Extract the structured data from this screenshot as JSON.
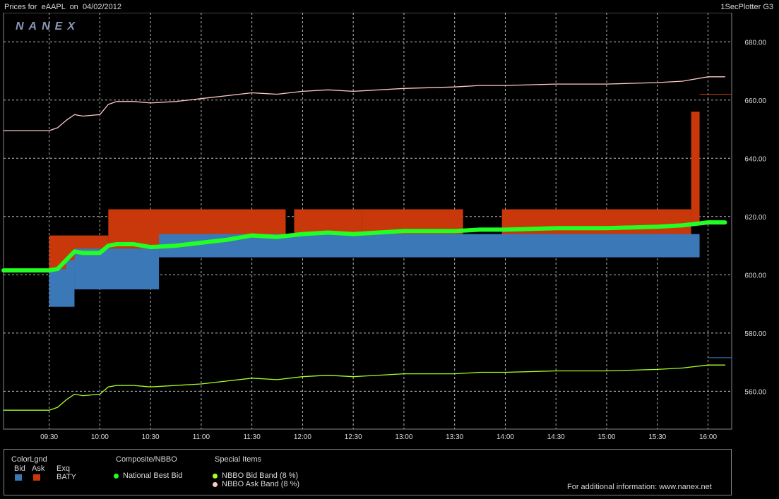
{
  "header": {
    "title_prefix": "Prices for",
    "symbol": "eAAPL",
    "on_label": "on",
    "date": "04/02/2012",
    "app_name": "1SecPlotter G3"
  },
  "logo_text": "NANEX",
  "chart_data": {
    "type": "line",
    "xlim": [
      "09:03",
      "16:14"
    ],
    "ylim": [
      547,
      690
    ],
    "grid": true,
    "x_ticks": [
      "09:30",
      "10:00",
      "10:30",
      "11:00",
      "11:30",
      "12:00",
      "12:30",
      "13:00",
      "13:30",
      "14:00",
      "14:30",
      "15:00",
      "15:30",
      "16:00"
    ],
    "y_ticks": [
      "560.00",
      "580.00",
      "600.00",
      "620.00",
      "640.00",
      "660.00",
      "680.00"
    ],
    "series": [
      {
        "name": "National Best Bid",
        "color": "#22ff22",
        "x": [
          "09:03",
          "09:30",
          "09:35",
          "09:40",
          "09:45",
          "09:50",
          "10:00",
          "10:05",
          "10:10",
          "10:20",
          "10:30",
          "10:45",
          "11:00",
          "11:15",
          "11:30",
          "11:45",
          "12:00",
          "12:15",
          "12:30",
          "13:00",
          "13:30",
          "13:45",
          "14:00",
          "14:30",
          "15:00",
          "15:30",
          "15:45",
          "16:00",
          "16:10"
        ],
        "y": [
          601.5,
          601.5,
          602.0,
          605.0,
          608.0,
          607.5,
          607.5,
          610.0,
          610.5,
          610.5,
          609.5,
          610.0,
          611.0,
          612.0,
          613.5,
          613.0,
          614.0,
          614.5,
          614.0,
          615.0,
          615.0,
          615.5,
          615.5,
          616.0,
          616.0,
          616.5,
          617.0,
          618.0,
          618.0
        ]
      },
      {
        "name": "NBBO Bid Band (8 %)",
        "color": "#aaff22",
        "x": [
          "09:03",
          "09:30",
          "09:35",
          "09:40",
          "09:45",
          "09:50",
          "10:00",
          "10:05",
          "10:10",
          "10:20",
          "10:30",
          "10:45",
          "11:00",
          "11:15",
          "11:30",
          "11:45",
          "12:00",
          "12:15",
          "12:30",
          "13:00",
          "13:30",
          "13:45",
          "14:00",
          "14:30",
          "15:00",
          "15:30",
          "15:45",
          "16:00",
          "16:10"
        ],
        "y": [
          553.5,
          553.5,
          554.5,
          557.0,
          559.0,
          558.5,
          559.0,
          561.5,
          562.0,
          562.0,
          561.5,
          562.0,
          562.5,
          563.5,
          564.5,
          564.0,
          565.0,
          565.5,
          565.0,
          566.0,
          566.0,
          566.5,
          566.5,
          567.0,
          567.0,
          567.5,
          568.0,
          569.0,
          569.0
        ]
      },
      {
        "name": "NBBO Ask Band (8 %)",
        "color": "#ffc8c8",
        "x": [
          "09:03",
          "09:30",
          "09:35",
          "09:40",
          "09:45",
          "09:50",
          "10:00",
          "10:05",
          "10:10",
          "10:20",
          "10:30",
          "10:45",
          "11:00",
          "11:15",
          "11:30",
          "11:45",
          "12:00",
          "12:15",
          "12:30",
          "13:00",
          "13:30",
          "13:45",
          "14:00",
          "14:30",
          "15:00",
          "15:30",
          "15:45",
          "16:00",
          "16:10"
        ],
        "y": [
          649.5,
          649.5,
          650.5,
          653.0,
          655.0,
          654.5,
          655.0,
          658.5,
          659.5,
          659.5,
          659.0,
          659.5,
          660.5,
          661.5,
          662.5,
          662.0,
          663.0,
          663.5,
          663.0,
          664.0,
          664.5,
          665.0,
          665.0,
          665.5,
          665.5,
          666.0,
          666.5,
          668.0,
          668.0
        ]
      }
    ],
    "bid_segments": [
      {
        "x": [
          "09:30",
          "09:40"
        ],
        "low": 589,
        "high": 602
      },
      {
        "x": [
          "09:40",
          "09:45"
        ],
        "low": 589,
        "high": 605
      },
      {
        "x": [
          "09:45",
          "10:35"
        ],
        "low": 595,
        "high": 609
      },
      {
        "x": [
          "10:35",
          "15:55"
        ],
        "low": 606,
        "high": 614
      }
    ],
    "ask_segments": [
      {
        "x": [
          "09:30",
          "10:05"
        ],
        "low": 602,
        "high": 613.5
      },
      {
        "x": [
          "10:05",
          "11:50"
        ],
        "low": 608,
        "high": 622.5
      },
      {
        "x": [
          "11:55",
          "12:35"
        ],
        "low": 608,
        "high": 622.5
      },
      {
        "x": [
          "12:35",
          "13:35"
        ],
        "low": 608,
        "high": 622.5
      },
      {
        "x": [
          "13:58",
          "15:50"
        ],
        "low": 608,
        "high": 622.5
      },
      {
        "x": [
          "15:50",
          "15:55"
        ],
        "low": 618,
        "high": 656
      },
      {
        "x": [
          "15:55",
          "16:14"
        ],
        "low": 662,
        "high": 662
      }
    ],
    "bid_right_tick": {
      "x": [
        "16:00",
        "16:14"
      ],
      "y": 571.5
    }
  },
  "legend": {
    "colorlgnd_title": "ColorLgnd",
    "bid_label": "Bid",
    "ask_label": "Ask",
    "exq_label": "Exq",
    "exchange": "BATY",
    "bid_color": "#3a78b8",
    "ask_color": "#c8380a",
    "composite_title": "Composite/NBBO",
    "national_best_bid": "National Best Bid",
    "special_title": "Special Items",
    "bid_band": "NBBO Bid Band (8 %)",
    "ask_band": "NBBO Ask Band (8 %)",
    "info": "For additional information: www.nanex.net"
  }
}
